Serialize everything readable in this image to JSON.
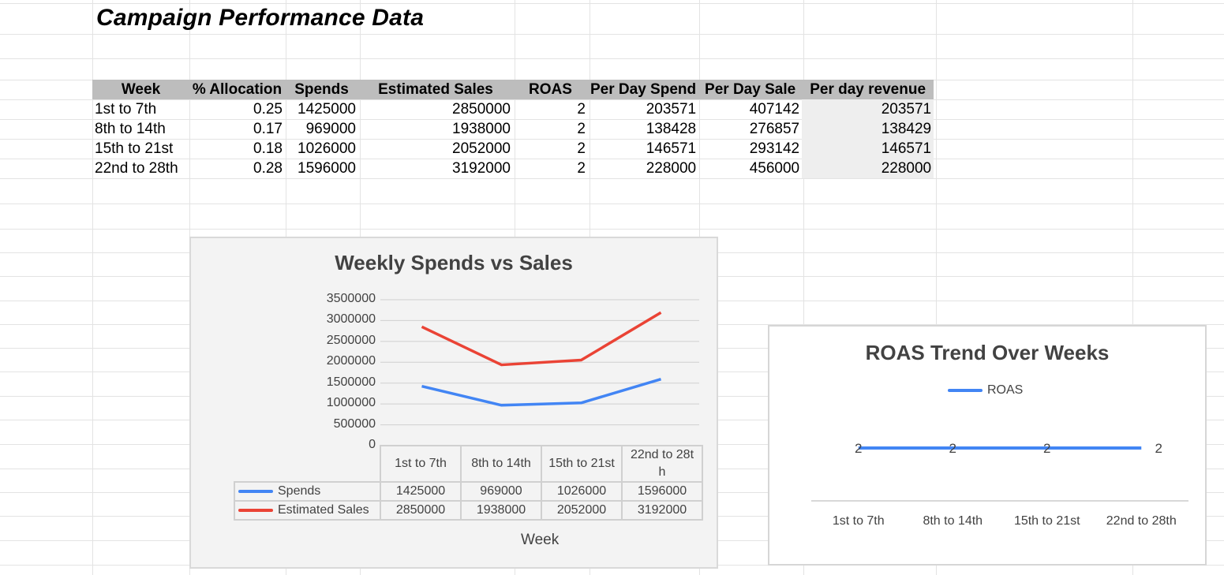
{
  "sheet": {
    "title": "Campaign Performance Data"
  },
  "table": {
    "headers": [
      "Week",
      "% Allocation",
      "Spends",
      "Estimated Sales",
      "ROAS",
      "Per Day Spend",
      "Per Day Sale",
      "Per day revenue"
    ],
    "rows": [
      [
        "1st to 7th",
        "0.25",
        "1425000",
        "2850000",
        "2",
        "203571",
        "407142",
        "203571"
      ],
      [
        "8th to 14th",
        "0.17",
        "969000",
        "1938000",
        "2",
        "138428",
        "276857",
        "138429"
      ],
      [
        "15th to 21st",
        "0.18",
        "1026000",
        "2052000",
        "2",
        "146571",
        "293142",
        "146571"
      ],
      [
        "22nd to 28th",
        "0.28",
        "1596000",
        "3192000",
        "2",
        "228000",
        "456000",
        "228000"
      ]
    ]
  },
  "chart_data": [
    {
      "type": "line",
      "title": "Weekly Spends vs Sales",
      "xlabel": "Week",
      "ylabel": "",
      "categories": [
        "1st to 7th",
        "8th to 14th",
        "15th to 21st",
        "22nd to 28t h"
      ],
      "series": [
        {
          "name": "Spends",
          "values": [
            1425000,
            969000,
            1026000,
            1596000
          ],
          "color": "#4285f4"
        },
        {
          "name": "Estimated Sales",
          "values": [
            2850000,
            1938000,
            2052000,
            3192000
          ],
          "color": "#ea4335"
        }
      ],
      "ylim": [
        0,
        3500000
      ],
      "yticks": [
        "3500000",
        "3000000",
        "2500000",
        "2000000",
        "1500000",
        "1000000",
        "500000",
        "0"
      ],
      "grid": true,
      "legend": "data-table",
      "data_table": {
        "rows": [
          {
            "name": "Spends",
            "values": [
              "1425000",
              "969000",
              "1026000",
              "1596000"
            ]
          },
          {
            "name": "Estimated Sales",
            "values": [
              "2850000",
              "1938000",
              "2052000",
              "3192000"
            ]
          }
        ]
      }
    },
    {
      "type": "line",
      "title": "ROAS Trend Over Weeks",
      "xlabel": "",
      "ylabel": "",
      "categories": [
        "1st to 7th",
        "8th to 14th",
        "15th to 21st",
        "22nd to 28th"
      ],
      "series": [
        {
          "name": "ROAS",
          "values": [
            2,
            2,
            2,
            2
          ],
          "color": "#4285f4"
        }
      ],
      "data_labels": [
        "2",
        "2",
        "2",
        "2"
      ],
      "legend": "top",
      "grid": false
    }
  ]
}
